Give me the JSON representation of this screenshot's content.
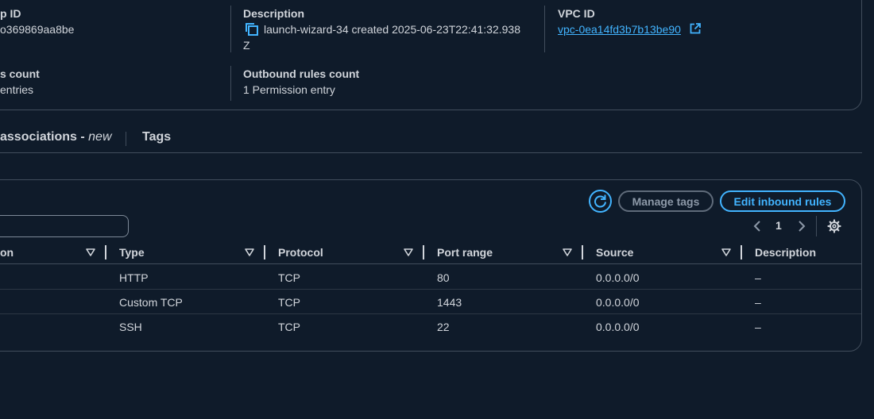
{
  "details": {
    "group_id": {
      "label": "p ID",
      "value": "o369869aa8be"
    },
    "description": {
      "label": "Description",
      "value": "launch-wizard-34 created 2025-06-23T22:41:32.938",
      "value_wrap": "Z"
    },
    "vpc": {
      "label": "VPC ID",
      "value": "vpc-0ea14fd3b7b13be90"
    },
    "inbound_count": {
      "label": "s count",
      "value": "entries"
    },
    "outbound_count": {
      "label": "Outbound rules count",
      "value": "1 Permission entry"
    }
  },
  "tabs": {
    "associations": {
      "label": "associations - ",
      "suffix": "new"
    },
    "tags": {
      "label": "Tags"
    }
  },
  "toolbar": {
    "manage_tags": "Manage tags",
    "edit_inbound": "Edit inbound rules",
    "page": "1"
  },
  "table": {
    "columns": [
      "on",
      "Type",
      "Protocol",
      "Port range",
      "Source",
      "Description"
    ],
    "rows": [
      {
        "type": "HTTP",
        "protocol": "TCP",
        "port": "80",
        "source": "0.0.0.0/0",
        "description": "–"
      },
      {
        "type": "Custom TCP",
        "protocol": "TCP",
        "port": "1443",
        "source": "0.0.0.0/0",
        "description": "–"
      },
      {
        "type": "SSH",
        "protocol": "TCP",
        "port": "22",
        "source": "0.0.0.0/0",
        "description": "–"
      }
    ]
  },
  "colors": {
    "background": "#0f1b2a",
    "border": "#414d5c",
    "accent": "#42b4ff",
    "text": "#d1d5db",
    "disabled": "#8d99a8"
  },
  "icons": [
    "copy-icon",
    "external-link-icon",
    "refresh-icon",
    "chevron-left-icon",
    "chevron-right-icon",
    "settings-gear-icon",
    "filter-caret-icon"
  ]
}
